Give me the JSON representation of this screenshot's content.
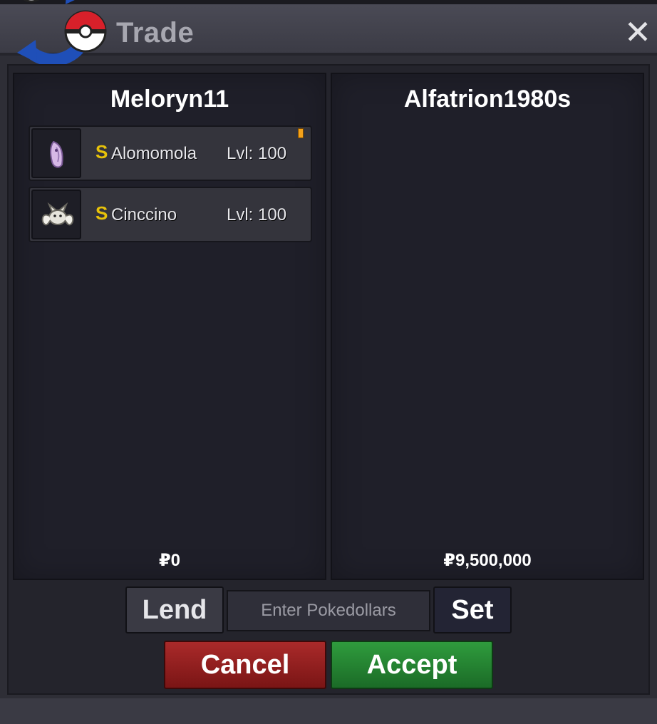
{
  "window": {
    "title": "Trade",
    "close_symbol": "✕",
    "logo_icon": "trade-pokeball-arrows-icon"
  },
  "left_panel": {
    "player": "Meloryn11",
    "money": "₽0",
    "pokemon": [
      {
        "shiny": "S",
        "name": "Alomomola",
        "level": "Lvl: 100",
        "held_item": true,
        "icon": "alomomola-icon"
      },
      {
        "shiny": "S",
        "name": "Cinccino",
        "level": "Lvl: 100",
        "held_item": false,
        "icon": "cinccino-icon"
      }
    ]
  },
  "right_panel": {
    "player": "Alfatrion1980s",
    "money": "₽9,500,000"
  },
  "controls": {
    "lend_label": "Lend",
    "pokedollars_placeholder": "Enter Pokedollars",
    "set_label": "Set",
    "cancel_label": "Cancel",
    "accept_label": "Accept"
  },
  "colors": {
    "cancel": "#9a2020",
    "accept": "#2a8a36",
    "shiny": "#e7c20a"
  }
}
